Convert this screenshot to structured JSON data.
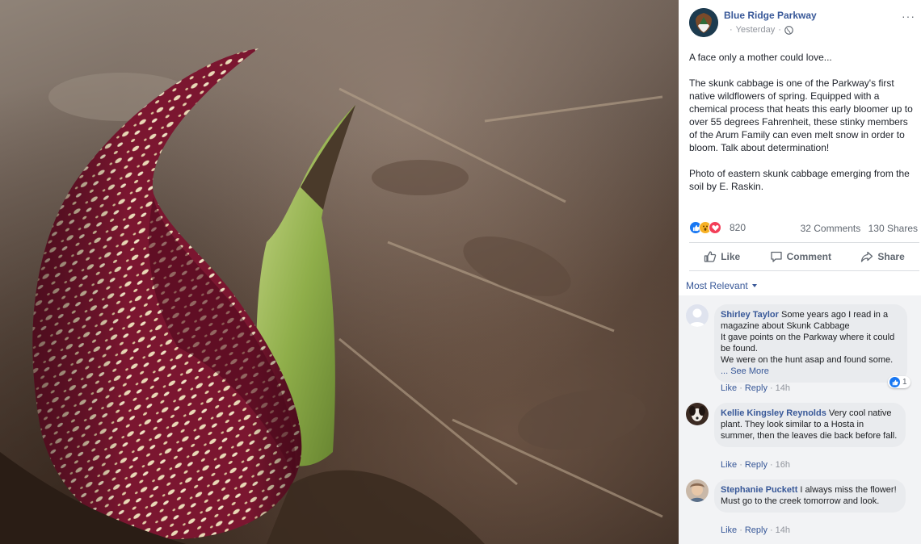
{
  "page": {
    "name": "Blue Ridge Parkway",
    "time": "Yesterday"
  },
  "post": {
    "paragraphs": [
      "A face only a mother could love...",
      "The skunk cabbage is one of the Parkway's first native wildflowers of spring. Equipped with a chemical process that heats this early bloomer up to over 55 degrees Fahrenheit, these stinky members of the Arum Family can even melt snow in order to bloom. Talk about determination!",
      "Photo of eastern skunk cabbage emerging from the soil by E. Raskin."
    ]
  },
  "reactions": {
    "count": "820",
    "comments": "32 Comments",
    "shares": "130 Shares"
  },
  "actions": {
    "like": "Like",
    "comment": "Comment",
    "share": "Share"
  },
  "sort": {
    "label": "Most Relevant"
  },
  "comments": [
    {
      "name": "Shirley Taylor",
      "text": "Some years ago I read in a magazine about Skunk Cabbage",
      "line2": "It gave points on the Parkway where it could be found.",
      "line3": "We were on the hunt asap and found some.",
      "see_more": "... See More",
      "like": "Like",
      "reply": "Reply",
      "time": "14h",
      "reactions": "1"
    },
    {
      "name": "Kellie Kingsley Reynolds",
      "text": "Very cool native plant. They look similar to a Hosta in summer, then the leaves die back before fall.",
      "like": "Like",
      "reply": "Reply",
      "time": "16h"
    },
    {
      "name": "Stephanie Puckett",
      "text": "I always miss the flower! Must go to the creek tomorrow and look.",
      "like": "Like",
      "reply": "Reply",
      "time": "14h"
    }
  ],
  "colors": {
    "link": "#385898",
    "meta": "#90949c",
    "bubble": "#e9ebee",
    "like_blue": "#1877f2"
  }
}
